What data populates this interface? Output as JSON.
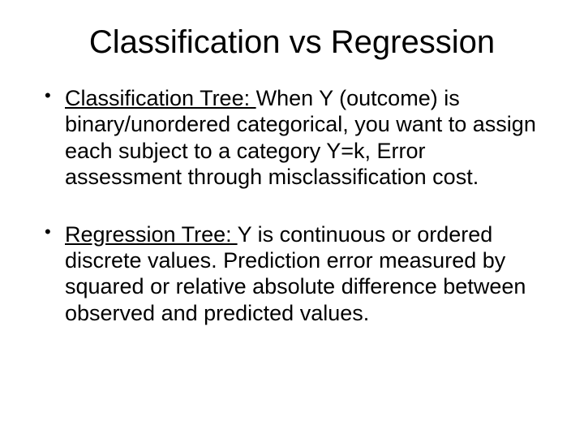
{
  "title": "Classification vs Regression",
  "bullets": [
    {
      "label": "Classification Tree: ",
      "text": "When Y (outcome) is binary/unordered categorical, you want to assign each subject to  a category Y=k, Error assessment through misclassification cost."
    },
    {
      "label": "Regression Tree:  ",
      "text": "Y is continuous or ordered discrete values. Prediction error measured by squared or relative absolute difference between observed and predicted values."
    }
  ]
}
